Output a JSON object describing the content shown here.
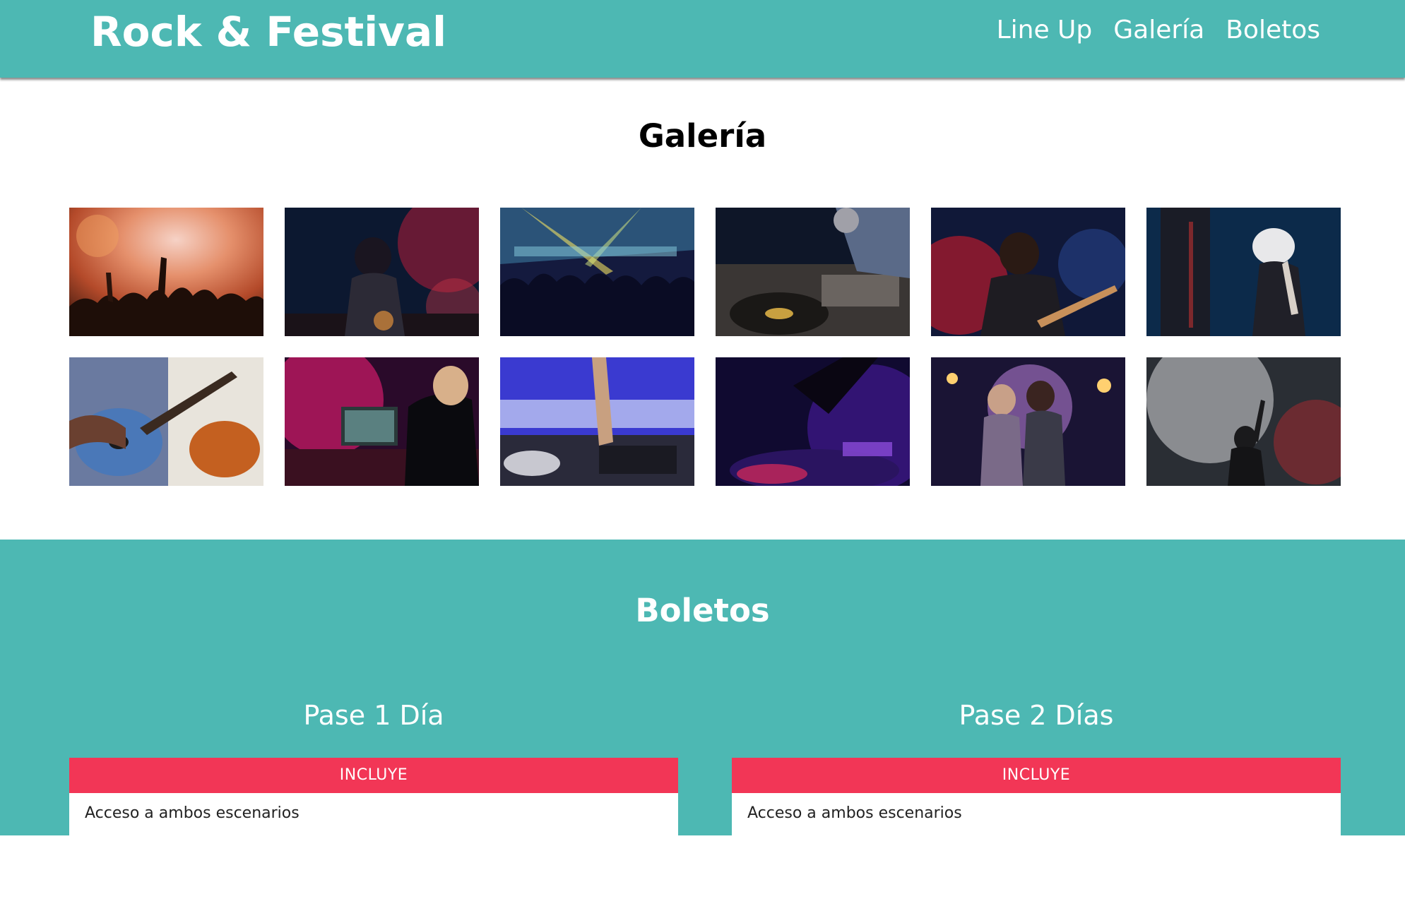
{
  "header": {
    "logo": "Rock & Festival",
    "nav": [
      "Line Up",
      "Galería",
      "Boletos"
    ]
  },
  "gallery": {
    "title": "Galería",
    "photos": [
      {
        "name": "crowd-orange-stage-photo"
      },
      {
        "name": "singer-red-stage-photo"
      },
      {
        "name": "club-crowd-lights-photo"
      },
      {
        "name": "dj-turntables-photo"
      },
      {
        "name": "guitarist-red-light-photo"
      },
      {
        "name": "dj-headphones-cap-photo"
      },
      {
        "name": "guitars-closeup-photo"
      },
      {
        "name": "dj-laptop-pink-photo"
      },
      {
        "name": "dj-mixer-blue-photo"
      },
      {
        "name": "dj-controller-purple-photo"
      },
      {
        "name": "band-duo-stage-photo"
      },
      {
        "name": "singer-smoke-photo"
      }
    ]
  },
  "boletos": {
    "title": "Boletos",
    "passes": [
      {
        "name": "Pase 1 Día",
        "header": "INCLUYE",
        "first_item": "Acceso a ambos escenarios"
      },
      {
        "name": "Pase 2 Días",
        "header": "INCLUYE",
        "first_item": "Acceso a ambos escenarios"
      }
    ]
  },
  "colors": {
    "teal": "#4db8b3",
    "pink": "#f23656",
    "white": "#ffffff"
  }
}
